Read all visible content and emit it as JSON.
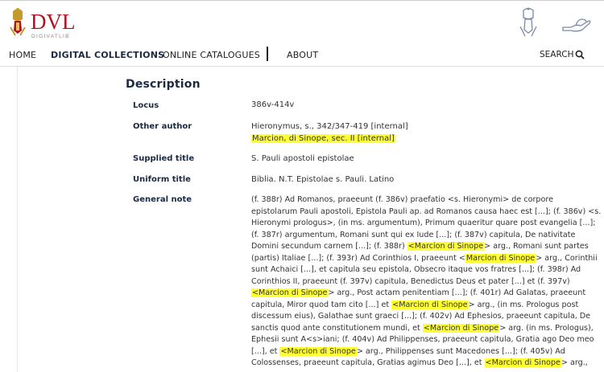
{
  "brand": {
    "logo_text": "DVL",
    "logo_sub": "DIGIVATLIB"
  },
  "nav": {
    "home": "HOME",
    "digital_collections": "DIGITAL COLLECTIONS",
    "online_catalogues": "ONLINE CATALOGUES",
    "about": "ABOUT",
    "search": "SEARCH"
  },
  "description": {
    "title": "Description",
    "fields": [
      {
        "label": "Locus",
        "values": [
          "386v-414v"
        ]
      },
      {
        "label": "Other author",
        "values": [
          "Hieronymus, s., 342/347-419 [internal]",
          "Marcion, di Sinope, sec. II [internal]"
        ]
      },
      {
        "label": "Supplied title",
        "values": [
          "S. Pauli apostoli epistolae"
        ]
      },
      {
        "label": "Uniform title",
        "values": [
          "Biblia. N.T. Epistolae s. Pauli. Latino"
        ]
      },
      {
        "label": "General note",
        "values": []
      }
    ],
    "general_note_lines": [
      [
        "(f. 388r) Ad Romanos, praeeunt (f. 386v) praefatio <s. Hieronymi> de corpore"
      ],
      [
        "epistolarum Pauli apostoli, Epistola Pauli ap. ad Romanos causa haec est [...]; (f. 386v) <s."
      ],
      [
        "Hieronymi prologus>, (in ms. argumentum), Primum quaeritur quare post evangelia [...];"
      ],
      [
        "(f. 387r) argumentum, Romani sunt qui ex Iude [...]; (f. 387v) capitula, De nativitate"
      ],
      [
        "Domini secundum carnem [...]; (f. 388r) ",
        "<Marcion di Sinope",
        "> arg., Romani sunt partes"
      ],
      [
        "(partis) Italiae [...]; (f. 393r) Ad Corinthios I, praeeunt <",
        "Marcion di Sinope",
        "> arg., Corinthii"
      ],
      [
        "sunt Achaici [...], et capitula seu epistola, Obsecro itaque vos fratres [...]; (f. 398r) Ad"
      ],
      [
        "Corinthios II, praeeunt (f. 397v) capitula, Benedictus Deus et pater [...] et (f. 397v)"
      ],
      [
        "",
        "<Marcion di Sinope",
        "> arg., Post actam penitentiam [...]; (f. 401r) Ad Galatas, praeeunt"
      ],
      [
        "capitula, Miror quod tam cito [...] et ",
        "<Marcion di Sinope",
        "> arg., (in ms. Prologus post"
      ],
      [
        "discessum eius), Galathae sunt graeci [...]; (f. 402v) Ad Ephesios, praeeunt capitula, De"
      ],
      [
        "sanctis quod ante constitutionem mundi, et ",
        "<Marcion di Sinope",
        "> arg. (in ms. Prologus),"
      ],
      [
        "Ephesii sunt A<s>iani; (f. 404v) Ad Philippenses, praeeunt capitula, Gratia ago Deo meo"
      ],
      [
        "[...], et ",
        "<Marcion di Sinope",
        "> arg., Philippenses sunt Macedones [...]; (f. 405v) Ad"
      ],
      [
        "Colossenses, praeeunt capitula, Gratias agimus Deo [...], et ",
        "<Marcion di Sinope",
        "> arg.,"
      ]
    ]
  },
  "colors": {
    "highlight": "#ffff33",
    "navy": "#1b2a44",
    "brand_red": "#b0141e"
  }
}
